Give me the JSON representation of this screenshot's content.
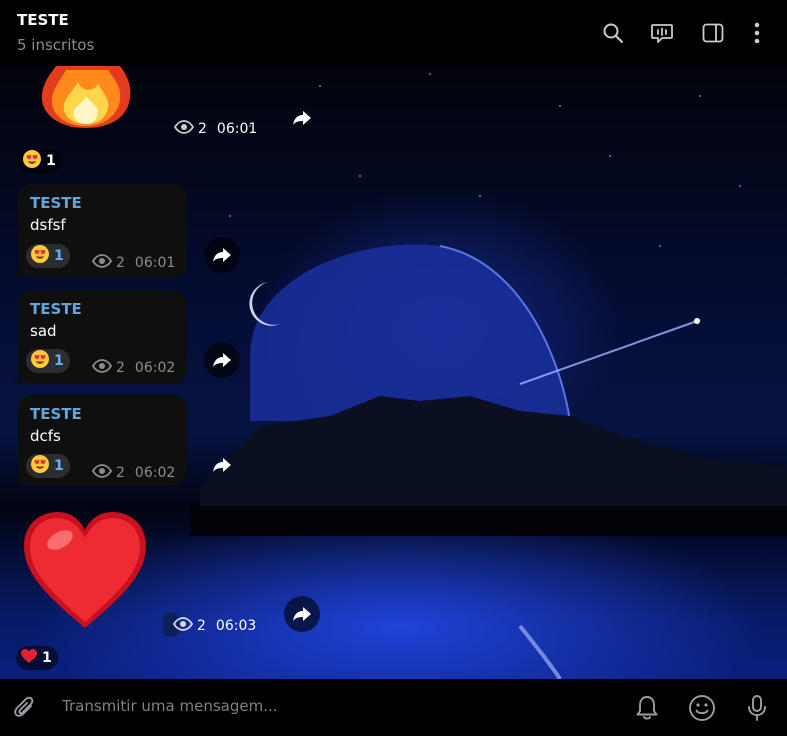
{
  "header": {
    "title": "TESTE",
    "subtitle": "5 inscritos"
  },
  "messages": [
    {
      "kind": "sticker",
      "sticker": "fire-emoji",
      "views": "2",
      "time": "06:01",
      "reaction": {
        "emoji": "heart-eyes-emoji",
        "count": "1"
      }
    },
    {
      "kind": "text",
      "sender": "TESTE",
      "text": "dsfsf",
      "views": "2",
      "time": "06:01",
      "reaction": {
        "emoji": "heart-eyes-emoji",
        "count": "1"
      }
    },
    {
      "kind": "text",
      "sender": "TESTE",
      "text": "sad",
      "views": "2",
      "time": "06:02",
      "reaction": {
        "emoji": "heart-eyes-emoji",
        "count": "1"
      }
    },
    {
      "kind": "text",
      "sender": "TESTE",
      "text": "dcfs",
      "views": "2",
      "time": "06:02",
      "reaction": {
        "emoji": "heart-eyes-emoji",
        "count": "1"
      }
    },
    {
      "kind": "sticker",
      "sticker": "red-heart-emoji",
      "views": "2",
      "time": "06:03",
      "reaction": {
        "emoji": "red-heart-emoji",
        "count": "1"
      }
    }
  ],
  "composer": {
    "placeholder": "Transmitir uma mensagem..."
  },
  "icons": {
    "header": [
      "search-icon",
      "voice-chat-icon",
      "sidebar-toggle-icon",
      "more-options-icon"
    ],
    "composer": [
      "attach-icon",
      "bell-icon",
      "emoji-icon",
      "microphone-icon"
    ],
    "message": [
      "eye-icon",
      "share-icon"
    ]
  },
  "colors": {
    "accent_sender": "#64a6d8",
    "reaction_count": "#5fb0ff",
    "bubble": "#0f0f10",
    "muted": "#8a8d91"
  }
}
